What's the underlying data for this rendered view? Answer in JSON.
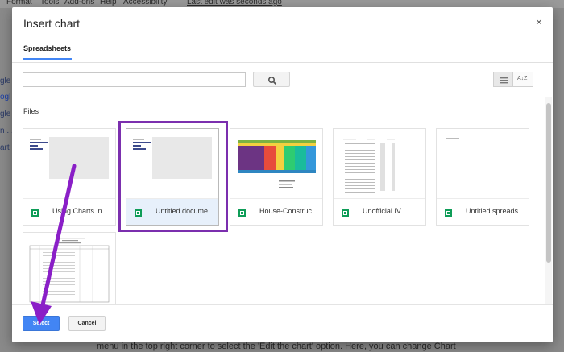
{
  "background": {
    "menu": [
      "Format",
      "Tools",
      "Add-ons",
      "Help",
      "Accessibility",
      "Last edit was seconds ago"
    ],
    "side_fragments": [
      "gle",
      "ogl",
      "gle",
      "n ...",
      "art"
    ],
    "bottom_text": "menu in the top right corner to select the 'Edit the chart' option. Here, you can change Chart"
  },
  "dialog": {
    "title": "Insert chart",
    "close_glyph": "×",
    "tab": "Spreadsheets",
    "search": {
      "value": "",
      "placeholder": ""
    },
    "section_label": "Files",
    "files": [
      {
        "title": "Using Charts in G..."
      },
      {
        "title": "Untitled documen...",
        "selected": true
      },
      {
        "title": "House-Constructi..."
      },
      {
        "title": "Unofficial IV"
      },
      {
        "title": "Untitled spreadsh..."
      },
      {
        "title": ""
      }
    ],
    "buttons": {
      "select": "Select",
      "cancel": "Cancel"
    },
    "sort_glyph": "A↓Z"
  },
  "annotation": {
    "highlight_color": "#7b2fae",
    "arrow_color": "#8a1fc7"
  }
}
